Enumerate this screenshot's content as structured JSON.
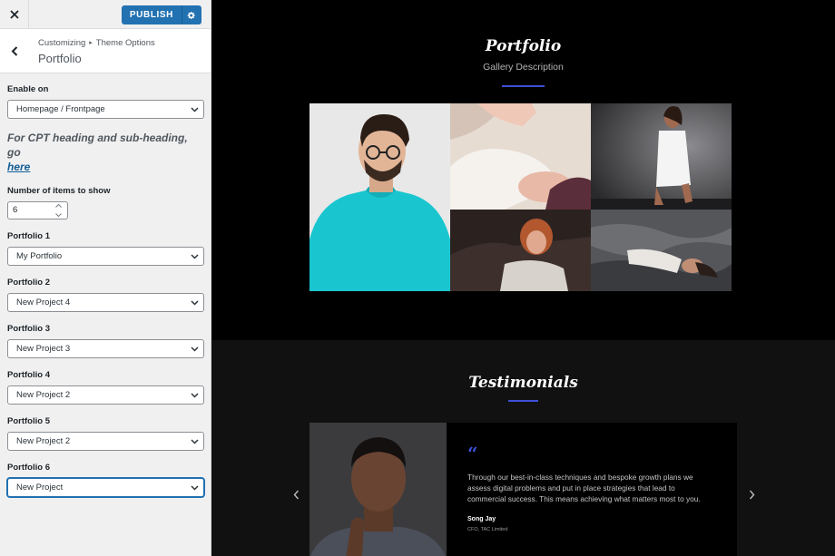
{
  "customizer": {
    "publish_label": "PUBLISH",
    "breadcrumb": {
      "root": "Customizing",
      "separator": "▸",
      "parent": "Theme Options"
    },
    "section_title": "Portfolio",
    "enable_on": {
      "label": "Enable on",
      "value": "Homepage / Frontpage"
    },
    "cpt_note": {
      "text": "For CPT heading and sub-heading, go",
      "link": "here"
    },
    "items_to_show": {
      "label": "Number of items to show",
      "value": "6"
    },
    "portfolios": [
      {
        "label": "Portfolio 1",
        "value": "My Portfolio"
      },
      {
        "label": "Portfolio 2",
        "value": "New Project 4"
      },
      {
        "label": "Portfolio 3",
        "value": "New Project 3"
      },
      {
        "label": "Portfolio 4",
        "value": "New Project 2"
      },
      {
        "label": "Portfolio 5",
        "value": "New Project 2"
      },
      {
        "label": "Portfolio 6",
        "value": "New Project"
      }
    ]
  },
  "preview": {
    "portfolio": {
      "title": "Portfolio",
      "description": "Gallery Description"
    },
    "testimonials": {
      "title": "Testimonials",
      "quote_mark": "“",
      "text": "Through our best-in-class techniques and bespoke growth plans we assess digital problems and put in place strategies that lead to commercial success. This means achieving what matters most to you.",
      "name": "Song Jay",
      "role": "CFO, TAC Limited"
    }
  },
  "colors": {
    "primary": "#2271b1",
    "accent": "#3d4fd8",
    "sidebar_bg": "#f0f0f1"
  }
}
